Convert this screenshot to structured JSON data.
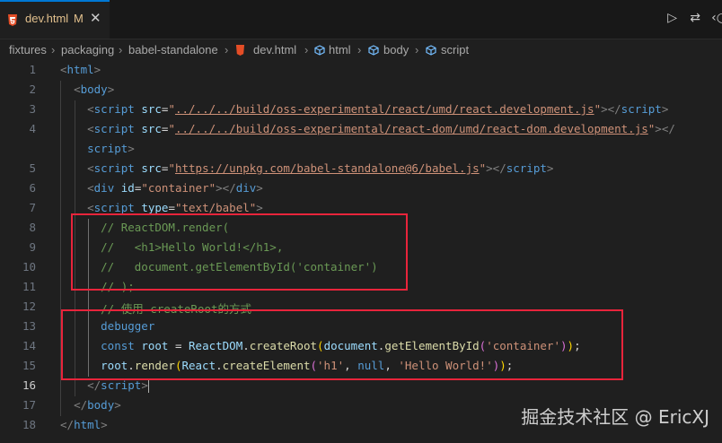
{
  "tab": {
    "filename": "dev.html",
    "modified": "M",
    "close_glyph": "✕"
  },
  "actions": {
    "run_glyph": "▷",
    "compare_glyph": "⇄",
    "more_glyph": "‹○"
  },
  "breadcrumb": [
    "fixtures",
    "packaging",
    "babel-standalone",
    "dev.html",
    "html",
    "body",
    "script"
  ],
  "editor": {
    "current_line": 16,
    "lines": [
      {
        "n": "1",
        "tokens": [
          [
            "p",
            "<"
          ],
          [
            "t",
            "html"
          ],
          [
            "p",
            ">"
          ]
        ]
      },
      {
        "n": "2",
        "tokens": [
          [
            "o",
            "  "
          ],
          [
            "p",
            "<"
          ],
          [
            "t",
            "body"
          ],
          [
            "p",
            ">"
          ]
        ]
      },
      {
        "n": "3",
        "tokens": [
          [
            "o",
            "    "
          ],
          [
            "p",
            "<"
          ],
          [
            "t",
            "script"
          ],
          [
            "o",
            " "
          ],
          [
            "a",
            "src"
          ],
          [
            "o",
            "="
          ],
          [
            "s",
            "\""
          ],
          [
            "u",
            "../../../build/oss-experimental/react/umd/react.development.js"
          ],
          [
            "s",
            "\""
          ],
          [
            "p",
            "></"
          ],
          [
            "t",
            "script"
          ],
          [
            "p",
            ">"
          ]
        ]
      },
      {
        "n": "4",
        "tokens": [
          [
            "o",
            "    "
          ],
          [
            "p",
            "<"
          ],
          [
            "t",
            "script"
          ],
          [
            "o",
            " "
          ],
          [
            "a",
            "src"
          ],
          [
            "o",
            "="
          ],
          [
            "s",
            "\""
          ],
          [
            "u",
            "../../../build/oss-experimental/react-dom/umd/react-dom.development.js"
          ],
          [
            "s",
            "\""
          ],
          [
            "p",
            "></"
          ]
        ]
      },
      {
        "n": "",
        "tokens": [
          [
            "o",
            "    "
          ],
          [
            "t",
            "script"
          ],
          [
            "p",
            ">"
          ]
        ]
      },
      {
        "n": "5",
        "tokens": [
          [
            "o",
            "    "
          ],
          [
            "p",
            "<"
          ],
          [
            "t",
            "script"
          ],
          [
            "o",
            " "
          ],
          [
            "a",
            "src"
          ],
          [
            "o",
            "="
          ],
          [
            "s",
            "\""
          ],
          [
            "u",
            "https://unpkg.com/babel-standalone@6/babel.js"
          ],
          [
            "s",
            "\""
          ],
          [
            "p",
            "></"
          ],
          [
            "t",
            "script"
          ],
          [
            "p",
            ">"
          ]
        ]
      },
      {
        "n": "6",
        "tokens": [
          [
            "o",
            "    "
          ],
          [
            "p",
            "<"
          ],
          [
            "t",
            "div"
          ],
          [
            "o",
            " "
          ],
          [
            "a",
            "id"
          ],
          [
            "o",
            "="
          ],
          [
            "s",
            "\"container\""
          ],
          [
            "p",
            "></"
          ],
          [
            "t",
            "div"
          ],
          [
            "p",
            ">"
          ]
        ]
      },
      {
        "n": "7",
        "tokens": [
          [
            "o",
            "    "
          ],
          [
            "p",
            "<"
          ],
          [
            "t",
            "script"
          ],
          [
            "o",
            " "
          ],
          [
            "a",
            "type"
          ],
          [
            "o",
            "="
          ],
          [
            "s",
            "\"text/babel\""
          ],
          [
            "p",
            ">"
          ]
        ]
      },
      {
        "n": "8",
        "tokens": [
          [
            "o",
            "      "
          ],
          [
            "c",
            "// ReactDOM.render("
          ]
        ]
      },
      {
        "n": "9",
        "tokens": [
          [
            "o",
            "      "
          ],
          [
            "c",
            "//   <h1>Hello World!</h1>,"
          ]
        ]
      },
      {
        "n": "10",
        "tokens": [
          [
            "o",
            "      "
          ],
          [
            "c",
            "//   document.getElementById('container')"
          ]
        ]
      },
      {
        "n": "11",
        "tokens": [
          [
            "o",
            "      "
          ],
          [
            "c",
            "// );"
          ]
        ]
      },
      {
        "n": "12",
        "tokens": [
          [
            "o",
            "      "
          ],
          [
            "c",
            "// 使用 createRoot的方式"
          ]
        ]
      },
      {
        "n": "13",
        "tokens": [
          [
            "o",
            "      "
          ],
          [
            "k",
            "debugger"
          ]
        ]
      },
      {
        "n": "14",
        "tokens": [
          [
            "o",
            "      "
          ],
          [
            "k",
            "const"
          ],
          [
            "o",
            " "
          ],
          [
            "v",
            "root"
          ],
          [
            "o",
            " = "
          ],
          [
            "v",
            "ReactDOM"
          ],
          [
            "o",
            "."
          ],
          [
            "f",
            "createRoot"
          ],
          [
            "y",
            "("
          ],
          [
            "v",
            "document"
          ],
          [
            "o",
            "."
          ],
          [
            "f",
            "getElementById"
          ],
          [
            "m",
            "("
          ],
          [
            "s",
            "'container'"
          ],
          [
            "m",
            ")"
          ],
          [
            "y",
            ")"
          ],
          [
            "o",
            ";"
          ]
        ]
      },
      {
        "n": "15",
        "tokens": [
          [
            "o",
            "      "
          ],
          [
            "v",
            "root"
          ],
          [
            "o",
            "."
          ],
          [
            "f",
            "render"
          ],
          [
            "y",
            "("
          ],
          [
            "v",
            "React"
          ],
          [
            "o",
            "."
          ],
          [
            "f",
            "createElement"
          ],
          [
            "m",
            "("
          ],
          [
            "s",
            "'h1'"
          ],
          [
            "o",
            ", "
          ],
          [
            "k",
            "null"
          ],
          [
            "o",
            ", "
          ],
          [
            "s",
            "'Hello World!'"
          ],
          [
            "m",
            ")"
          ],
          [
            "y",
            ")"
          ],
          [
            "o",
            ";"
          ]
        ]
      },
      {
        "n": "16",
        "tokens": [
          [
            "o",
            "    "
          ],
          [
            "p",
            "</"
          ],
          [
            "t",
            "script"
          ],
          [
            "p",
            ">"
          ]
        ]
      },
      {
        "n": "17",
        "tokens": [
          [
            "o",
            "  "
          ],
          [
            "p",
            "</"
          ],
          [
            "t",
            "body"
          ],
          [
            "p",
            ">"
          ]
        ]
      },
      {
        "n": "18",
        "tokens": [
          [
            "p",
            "</"
          ],
          [
            "t",
            "html"
          ],
          [
            "p",
            ">"
          ]
        ]
      }
    ]
  },
  "watermark": "掘金技术社区 @ EricXJ",
  "colors": {
    "annotation_box": "#e8243b",
    "tab_accent": "#0078d4",
    "modified_text": "#e2c08d"
  }
}
